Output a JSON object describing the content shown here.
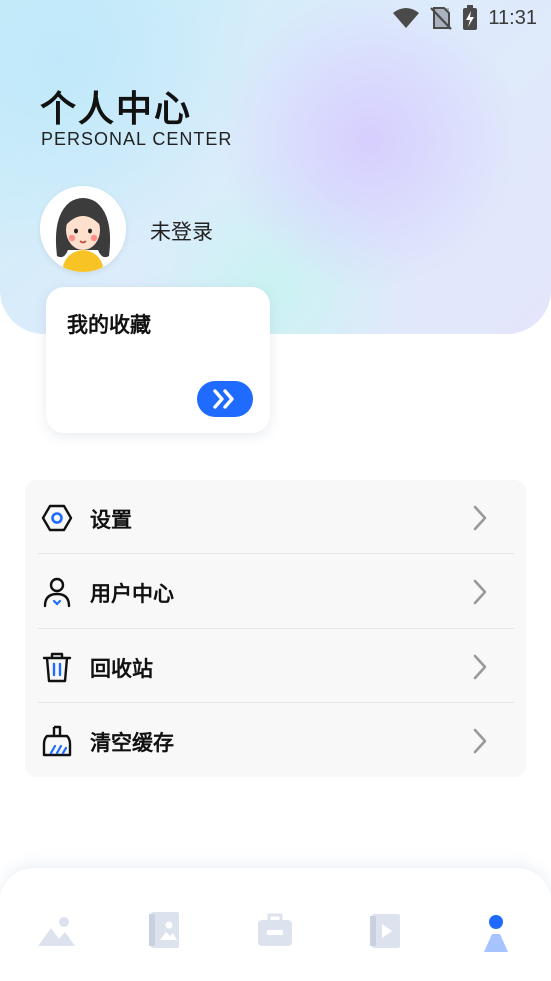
{
  "status_bar": {
    "time": "11:31",
    "icons": [
      "wifi-icon",
      "no-sim-icon",
      "battery-charging-icon"
    ]
  },
  "header": {
    "title": "个人中心",
    "subtitle": "PERSONAL CENTER"
  },
  "profile": {
    "avatar_icon": "avatar-girl-icon",
    "login_status": "未登录"
  },
  "favorites": {
    "title": "我的收藏",
    "arrow_icon": "double-chevron-right-icon"
  },
  "menu": {
    "items": [
      {
        "label": "设置",
        "icon": "settings-icon"
      },
      {
        "label": "用户中心",
        "icon": "user-icon"
      },
      {
        "label": "回收站",
        "icon": "trash-icon"
      },
      {
        "label": "清空缓存",
        "icon": "broom-icon"
      }
    ]
  },
  "tabs": {
    "items": [
      {
        "icon": "gallery-icon",
        "active": false
      },
      {
        "icon": "photo-album-icon",
        "active": false
      },
      {
        "icon": "toolbox-icon",
        "active": false
      },
      {
        "icon": "video-icon",
        "active": false
      },
      {
        "icon": "profile-icon",
        "active": true
      }
    ],
    "active_color": "#1f6bff",
    "inactive_color": "#dde3ee"
  },
  "colors": {
    "accent": "#1f6bff",
    "text": "#111111",
    "menu_bg": "#f8f8f8"
  }
}
